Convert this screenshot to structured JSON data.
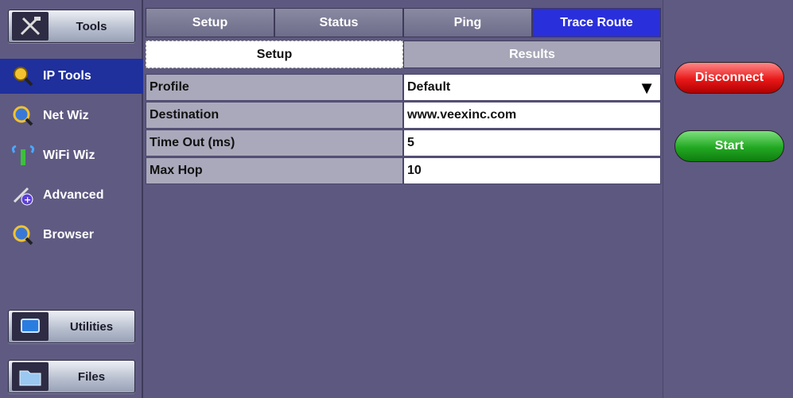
{
  "sidebar": {
    "tools_label": "Tools",
    "nav": [
      {
        "label": "IP Tools",
        "icon": "ip-tools-icon",
        "active": true
      },
      {
        "label": "Net Wiz",
        "icon": "net-wiz-icon",
        "active": false
      },
      {
        "label": "WiFi Wiz",
        "icon": "wifi-wiz-icon",
        "active": false
      },
      {
        "label": "Advanced",
        "icon": "advanced-icon",
        "active": false
      },
      {
        "label": "Browser",
        "icon": "browser-icon",
        "active": false
      }
    ],
    "utilities_label": "Utilities",
    "files_label": "Files"
  },
  "tabs": [
    {
      "label": "Setup",
      "active": false
    },
    {
      "label": "Status",
      "active": false
    },
    {
      "label": "Ping",
      "active": false
    },
    {
      "label": "Trace Route",
      "active": true
    }
  ],
  "subtabs": [
    {
      "label": "Setup",
      "active": true
    },
    {
      "label": "Results",
      "active": false
    }
  ],
  "fields": [
    {
      "label": "Profile",
      "value": "Default",
      "dropdown": true
    },
    {
      "label": "Destination",
      "value": "www.veexinc.com",
      "dropdown": false
    },
    {
      "label": "Time Out (ms)",
      "value": "5",
      "dropdown": false
    },
    {
      "label": "Max Hop",
      "value": "10",
      "dropdown": false
    }
  ],
  "actions": {
    "disconnect_label": "Disconnect",
    "start_label": "Start"
  },
  "colors": {
    "background": "#5d587f",
    "active_tab": "#2a2fdc",
    "active_nav": "#1f2f9c",
    "disconnect": "#e81818",
    "start": "#22a822"
  }
}
